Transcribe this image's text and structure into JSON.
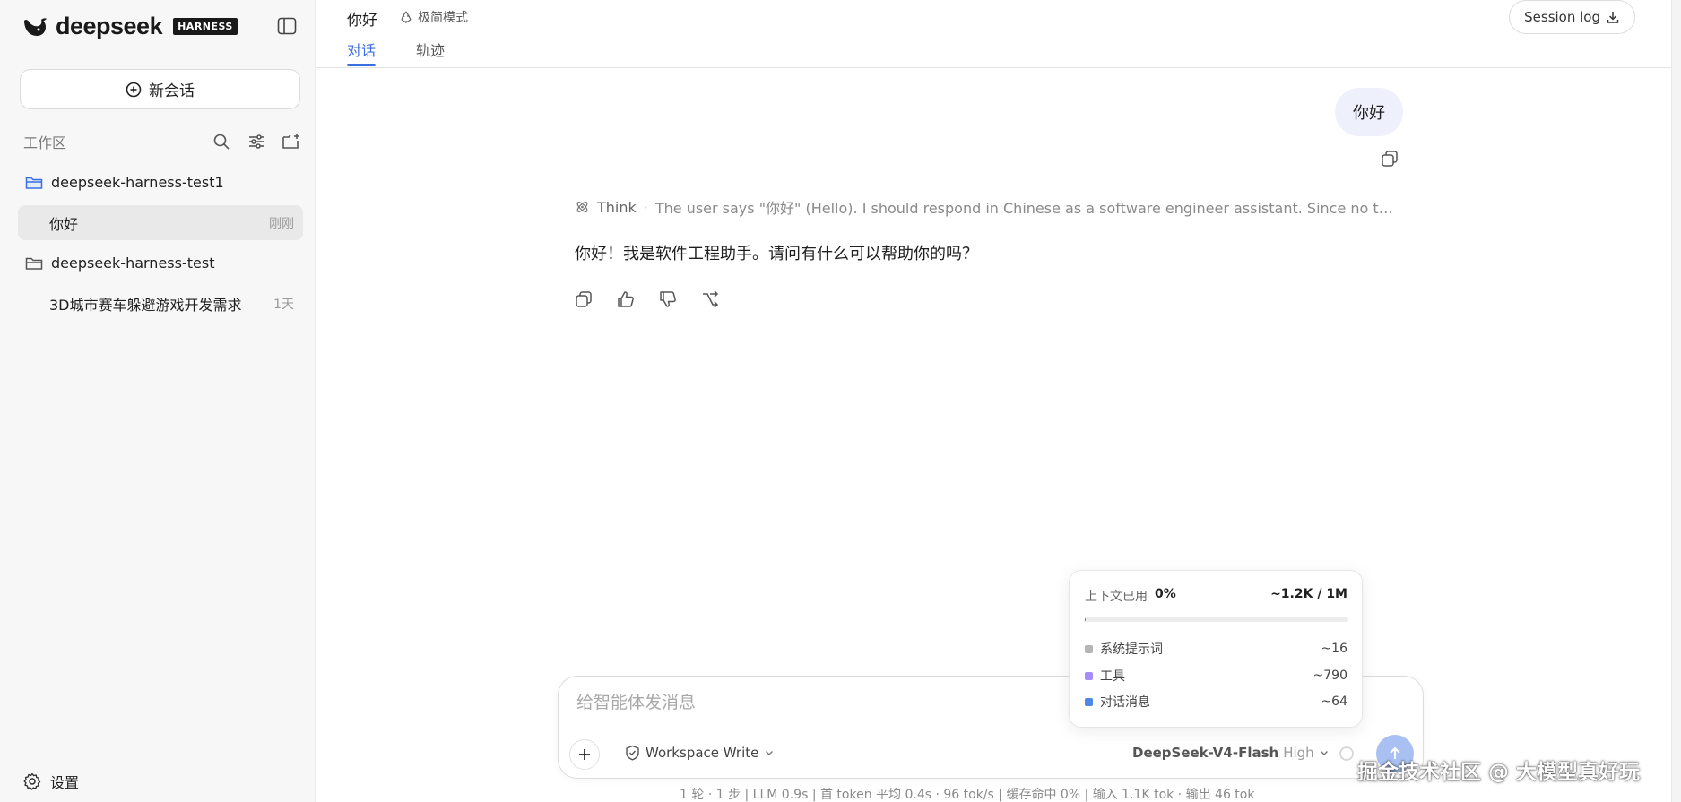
{
  "sidebar": {
    "logo_text": "deepseek",
    "logo_badge": "HARNESS",
    "new_chat_label": "新会话",
    "workspace_title": "工作区",
    "workspaces": [
      {
        "name": "deepseek-harness-test1",
        "sessions": [
          {
            "name": "你好",
            "time": "刚刚"
          }
        ]
      },
      {
        "name": "deepseek-harness-test",
        "sessions": [
          {
            "name": "3D城市赛车躲避游戏开发需求",
            "time": "1天"
          }
        ]
      }
    ],
    "settings_label": "设置"
  },
  "header": {
    "title": "你好",
    "mode_label": "极简模式",
    "tabs": [
      {
        "label": "对话"
      },
      {
        "label": "轨迹"
      }
    ],
    "session_log_label": "Session log"
  },
  "conversation": {
    "user_message": "你好",
    "think_label": "Think",
    "think_separator": "·",
    "think_text": "The user says \"你好\" (Hello). I should respond in Chinese as a software engineer assistant. Since no task spe...",
    "assistant_message": "你好！我是软件工程助手。请问有什么可以帮助你的吗？"
  },
  "context_popover": {
    "label": "上下文已用",
    "percent": "0%",
    "total": "~1.2K / 1M",
    "used_fraction": 0.001,
    "rows": [
      {
        "label": "系统提示词",
        "value": "~16",
        "color": "#b5b5b5"
      },
      {
        "label": "工具",
        "value": "~790",
        "color": "#a78bfa"
      },
      {
        "label": "对话消息",
        "value": "~64",
        "color": "#4f86e8"
      }
    ]
  },
  "composer": {
    "placeholder": "给智能体发消息",
    "permission_label": "Workspace Write",
    "model_name": "DeepSeek-V4-Flash",
    "model_level": "High"
  },
  "stats_text": "1 轮 · 1 步   |   LLM 0.9s   |   首 token 平均 0.4s · 96 tok/s   |   缓存命中 0%   |   输入 1.1K tok · 输出 46 tok",
  "watermark": "掘金技术社区 @ 大模型真好玩",
  "colors": {
    "accent": "#3b6ee0",
    "user_bubble": "#eef1fb",
    "send_button": "#a9c0f2"
  }
}
